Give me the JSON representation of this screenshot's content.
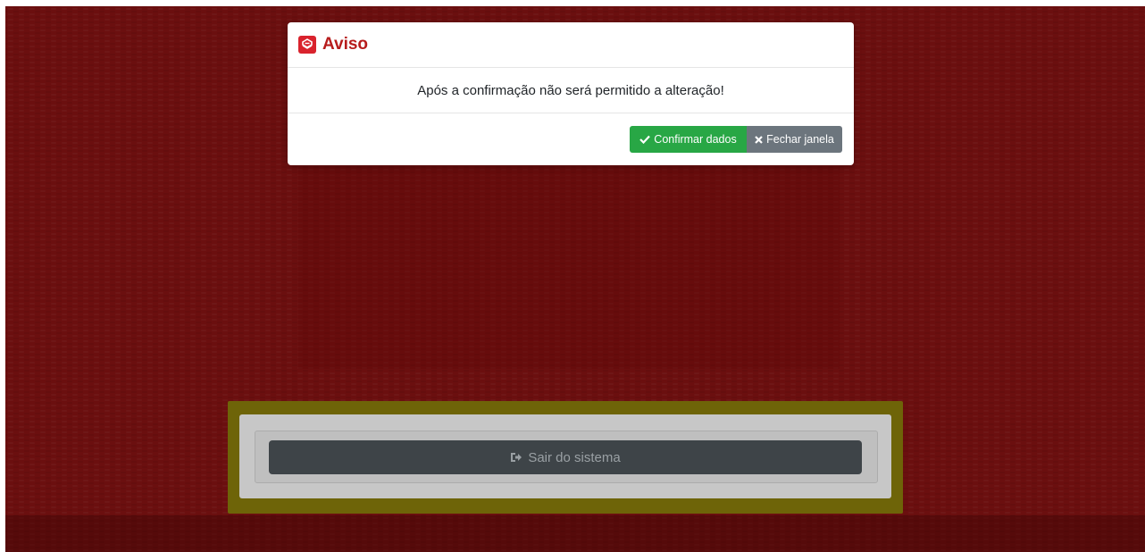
{
  "modal": {
    "title": "Aviso",
    "title_icon": "brand-logo-icon",
    "message": "Após a confirmação não será permitido a alteração!",
    "confirm_label": "Confirmar dados",
    "confirm_icon": "checkmark-icon",
    "close_label": "Fechar janela",
    "close_icon": "close-x-icon"
  },
  "logout": {
    "label": "Sair do sistema",
    "icon": "sign-out-icon"
  },
  "colors": {
    "background": "#8a1414",
    "title": "#b71c1c",
    "confirm": "#28a745",
    "close": "#6c757d",
    "highlight": "#6e6408"
  }
}
